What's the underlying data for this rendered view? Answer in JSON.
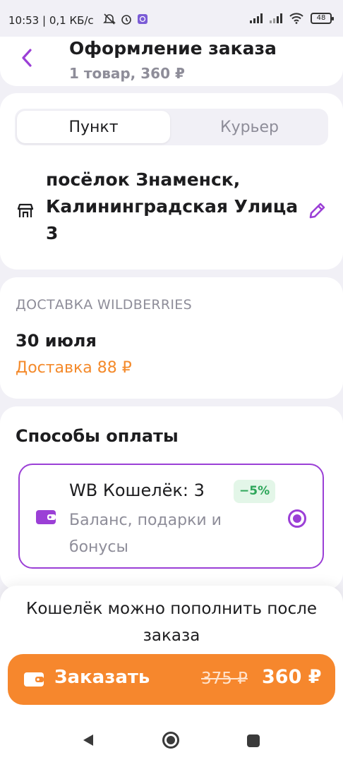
{
  "status_bar": {
    "time_text": "10:53 | 0,1 КБ/с",
    "battery": "48"
  },
  "header": {
    "title": "Оформление заказа",
    "subtitle": "1 товар, 360 ₽"
  },
  "delivery_mode": {
    "tabs": [
      "Пункт",
      "Курьер"
    ],
    "selected": "Пункт"
  },
  "address": {
    "text": "посёлок Знаменск, Калининградская Улица 3"
  },
  "delivery": {
    "label": "ДОСТАВКА WILDBERRIES",
    "date": "30 июля",
    "price": "Доставка 88 ₽"
  },
  "payment": {
    "title": "Способы оплаты",
    "method_name": "WB Кошелёк: 3",
    "discount_badge": "−5%",
    "method_desc": "Баланс, подарки и бонусы",
    "selected": true
  },
  "bottom": {
    "hint": "Кошелёк можно пополнить после заказа",
    "order_label": "Заказать",
    "old_price": "375 ₽",
    "new_price": "360 ₽"
  },
  "colors": {
    "accent_purple": "#9b3fd6",
    "order_orange": "#f6872d",
    "delivery_orange": "#f48a2b",
    "badge_green": "#2ea65a"
  }
}
